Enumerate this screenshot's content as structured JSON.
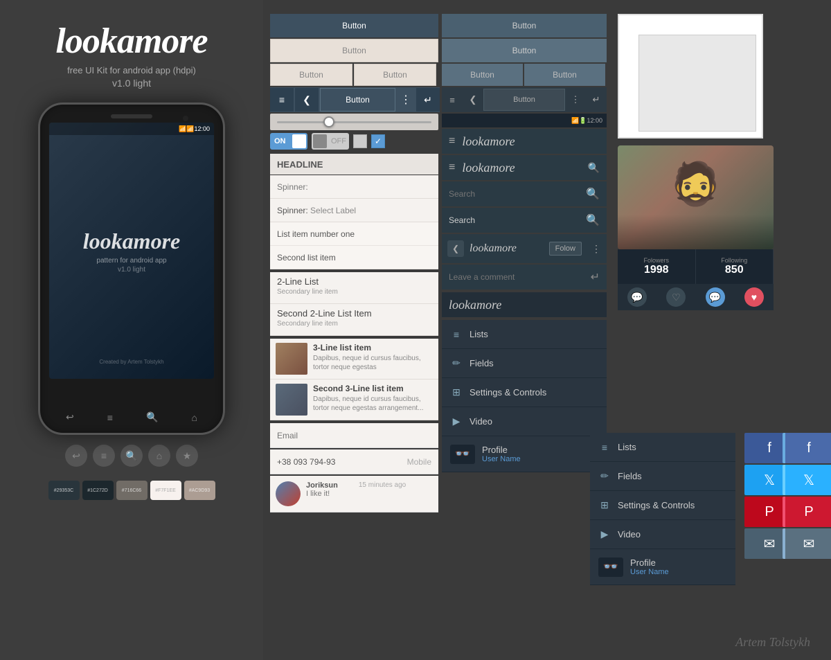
{
  "app": {
    "name": "lookamore",
    "tagline": "free UI Kit for android app (hdpi)",
    "version": "v1.0 light",
    "credit": "Artem Tolstykh",
    "phone_version": "v1.0 light",
    "phone_pattern": "pattern for android app",
    "phone_credit": "Created by Artem Tolstykh",
    "phone_time": "12:00"
  },
  "colors": {
    "dark1": "#29353C",
    "dark2": "#1C272D",
    "dark3": "#716C66",
    "light1": "#F7F1EE",
    "light2": "#AC9D93"
  },
  "buttons": {
    "primary": "Button",
    "secondary": "Button",
    "half1": "Button",
    "half2": "Button",
    "follow": "Folow",
    "leave_comment": "Leave a comment"
  },
  "list_items": {
    "headline": "HEADLINE",
    "spinner1": "Spinner:",
    "spinner2_label": "Spinner:",
    "spinner2_select": "Select Label",
    "item1": "List item number one",
    "item2": "Second list item",
    "two_line_1_primary": "2-Line List",
    "two_line_1_secondary": "Secondary line item",
    "two_line_2_primary": "Second 2-Line List Item",
    "two_line_2_secondary": "Secondary line item",
    "three_line_1_primary": "3-Line list item",
    "three_line_1_secondary": "Dapibus, neque id cursus faucibus, tortor neque egestas",
    "three_line_2_primary": "Second 3-Line list item",
    "three_line_2_secondary": "Dapibus, neque id cursus faucibus, tortor neque egestas arrangement..."
  },
  "fields": {
    "email_placeholder": "Email",
    "phone_value": "+38 093 794-93",
    "phone_label": "Mobile",
    "comment_author": "Joriksun",
    "comment_time": "15 minutes ago",
    "comment_text": "I like it!"
  },
  "dark_panel": {
    "app_name": "lookamore",
    "search_placeholder1": "Search",
    "search_placeholder2": "Search",
    "profile_name": "lookamore",
    "comment_placeholder": "Leave a comment",
    "logo_text": "lookamore"
  },
  "stats": {
    "followers_label": "Folowers",
    "followers_value": "1998",
    "following_label": "Following",
    "following_value": "850"
  },
  "nav_items": [
    {
      "icon": "≡",
      "label": "Lists"
    },
    {
      "icon": "✏",
      "label": "Fields"
    },
    {
      "icon": "⊞",
      "label": "Settings & Controls"
    },
    {
      "icon": "▶",
      "label": "Video"
    },
    {
      "icon": "👓",
      "label": "Profile"
    },
    {
      "username": "User Name"
    }
  ],
  "toggle": {
    "on_label": "ON",
    "off_label": "OFF"
  }
}
